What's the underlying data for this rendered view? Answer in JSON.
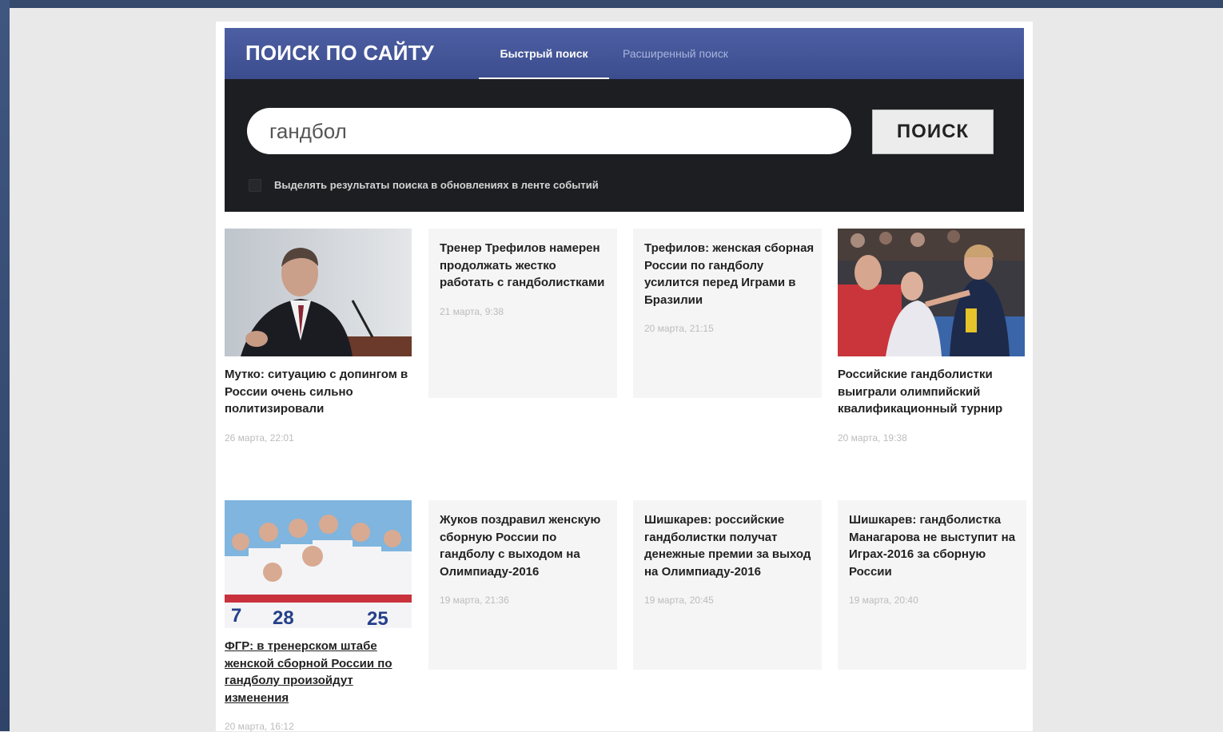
{
  "header": {
    "brand": "ПОИСК ПО САЙТУ",
    "tabs": [
      {
        "label": "Быстрый поиск",
        "active": true
      },
      {
        "label": "Расширенный поиск",
        "active": false
      }
    ]
  },
  "search": {
    "query": "гандбол",
    "button_label": "ПОИСК",
    "checkbox_label": "Выделять результаты поиска в обновлениях в ленте событий"
  },
  "results": [
    {
      "title": "Мутко: ситуацию с допингом в России очень сильно политизировали",
      "date": "26 марта, 22:01",
      "has_image": true,
      "image": "person-speaking-at-podium"
    },
    {
      "title": "Тренер Трефилов намерен продолжать жестко работать с гандболистками",
      "date": "21 марта, 9:38",
      "has_image": false
    },
    {
      "title": "Трефилов: женская сборная России по гандболу усилится перед Играми в Бразилии",
      "date": "20 марта, 21:15",
      "has_image": false
    },
    {
      "title": "Российские гандболистки выиграли олимпийский квалификационный турнир",
      "date": "20 марта, 19:38",
      "has_image": true,
      "image": "coach-and-players-on-court"
    },
    {
      "title": "ФГР: в тренерском штабе женской сборной России по гандболу произойдут изменения",
      "date": "20 марта, 16:12",
      "has_image": true,
      "image": "team-huddle"
    },
    {
      "title": "Жуков поздравил женскую сборную России по гандболу с выходом на Олимпиаду-2016",
      "date": "19 марта, 21:36",
      "has_image": false
    },
    {
      "title": "Шишкарев: российские гандболистки получат денежные премии за выход на Олимпиаду-2016",
      "date": "19 марта, 20:45",
      "has_image": false
    },
    {
      "title": "Шишкарев: гандболистка Манагарова не выступит на Играх-2016 за сборную России",
      "date": "19 марта, 20:40",
      "has_image": false
    }
  ]
}
